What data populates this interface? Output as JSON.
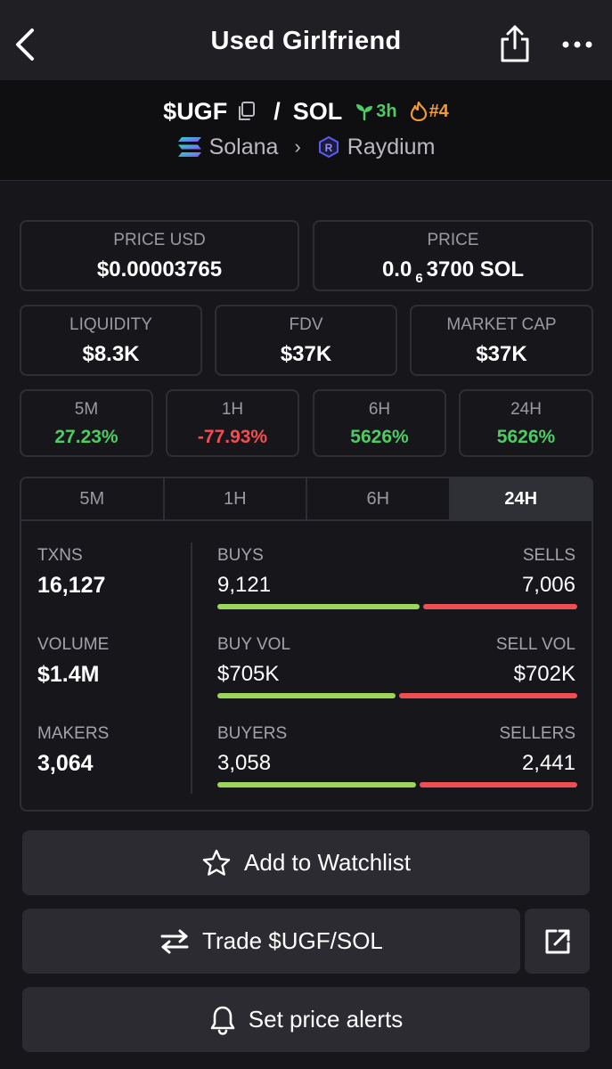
{
  "header": {
    "title": "Used Girlfriend",
    "back_icon": "chevron-left-icon",
    "share_icon": "share-icon",
    "more_icon": "more-horizontal-icon"
  },
  "pair": {
    "base_symbol": "$UGF",
    "separator": "/",
    "quote_symbol": "SOL",
    "age": "3h",
    "rank": "#4",
    "chain": "Solana",
    "dex": "Raydium"
  },
  "prices": {
    "price_usd_label": "PRICE USD",
    "price_usd_value": "$0.00003765",
    "price_label": "PRICE",
    "price_prefix": "0.0",
    "price_zero_count": "6",
    "price_suffix": "3700 SOL"
  },
  "stats": {
    "liquidity_label": "LIQUIDITY",
    "liquidity_value": "$8.3K",
    "fdv_label": "FDV",
    "fdv_value": "$37K",
    "mcap_label": "MARKET CAP",
    "mcap_value": "$37K"
  },
  "changes": [
    {
      "label": "5M",
      "value": "27.23%",
      "direction": "up"
    },
    {
      "label": "1H",
      "value": "-77.93%",
      "direction": "down"
    },
    {
      "label": "6H",
      "value": "5626%",
      "direction": "up"
    },
    {
      "label": "24H",
      "value": "5626%",
      "direction": "up"
    }
  ],
  "tabs": [
    "5M",
    "1H",
    "6H",
    "24H"
  ],
  "active_tab": "24H",
  "metrics": {
    "txns_label": "TXNS",
    "txns_value": "16,127",
    "volume_label": "VOLUME",
    "volume_value": "$1.4M",
    "makers_label": "MAKERS",
    "makers_value": "3,064",
    "buys_label": "BUYS",
    "buys_value": "9,121",
    "sells_label": "SELLS",
    "sells_value": "7,006",
    "buy_vol_label": "BUY VOL",
    "buy_vol_value": "$705K",
    "sell_vol_label": "SELL VOL",
    "sell_vol_value": "$702K",
    "buyers_label": "BUYERS",
    "buyers_value": "3,058",
    "sellers_label": "SELLERS",
    "sellers_value": "2,441",
    "buy_share_txns": 0.566,
    "buy_share_volume": 0.501,
    "buy_share_makers": 0.556
  },
  "actions": {
    "watchlist_label": "Add to Watchlist",
    "trade_label": "Trade $UGF/SOL",
    "alerts_label": "Set price alerts"
  },
  "colors": {
    "positive": "#4fca65",
    "negative": "#ef4f53",
    "buy_bar": "#9bd65a",
    "age_badge": "#4fca65",
    "rank_badge": "#f29b2f"
  }
}
